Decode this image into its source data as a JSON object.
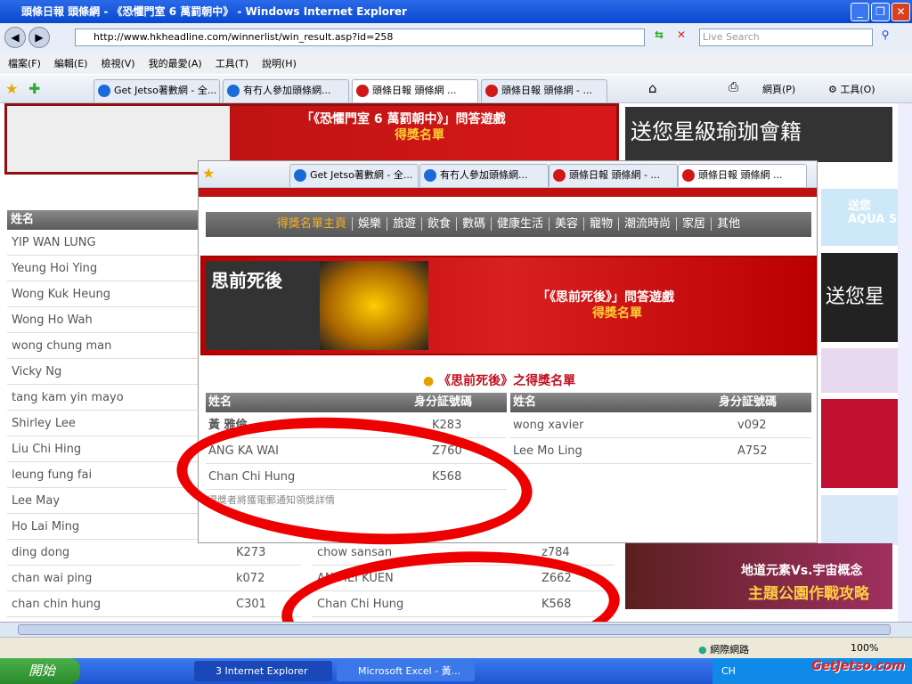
{
  "window": {
    "title": "頭條日報 頭條網 - 《恐懼門室 6 萬罰朝中》 - Windows Internet Explorer"
  },
  "address": {
    "url": "http://www.hkheadline.com/winnerlist/win_result.asp?id=258",
    "search_placeholder": "Live Search"
  },
  "menu": [
    "檔案(F)",
    "編輯(E)",
    "檢視(V)",
    "我的最愛(A)",
    "工具(T)",
    "說明(H)"
  ],
  "tabs": [
    "Get Jetso著數網 - 全...",
    "有冇人參加頭條網...",
    "頭條日報 頭條網 ...",
    "頭條日報 頭條網 - ..."
  ],
  "overlay_tabs": [
    "Get Jetso著數網 - 全...",
    "有冇人參加頭條網...",
    "頭條日報 頭條網 - ...",
    "頭條日報 頭條網 ..."
  ],
  "toolbar": {
    "page": "網頁(P)",
    "tools": "工具(O)"
  },
  "banner": {
    "title": "「《恐懼門室 6 萬罰朝中》」問答遊戲",
    "subtitle": "得獎名單",
    "ad": "送您星級瑜珈會籍"
  },
  "list": {
    "header": "姓名",
    "names": [
      "YIP WAN LUNG",
      "Yeung Hoi Ying",
      "Wong Kuk Heung",
      "Wong Ho Wah",
      "wong chung man",
      "Vicky Ng",
      "tang kam yin mayo",
      "Shirley Lee",
      "Liu Chi Hing",
      "leung fung fai",
      "Lee May",
      "Ho Lai Ming"
    ],
    "bottom_left": [
      {
        "name": "ding dong",
        "id": "K273"
      },
      {
        "name": "chan wai ping",
        "id": "k072"
      },
      {
        "name": "chan chin hung",
        "id": "C301"
      }
    ],
    "bottom_right": [
      {
        "name": "chow sansan",
        "id": "z784"
      },
      {
        "name": "AN MEI KUEN",
        "id": "Z662"
      },
      {
        "name": "Chan Chi Hung",
        "id": "K568"
      }
    ]
  },
  "overlay": {
    "nav": [
      "得獎名單主頁",
      "娛樂",
      "旅遊",
      "飲食",
      "數碼",
      "健康生活",
      "美容",
      "寵物",
      "潮流時尚",
      "家居",
      "其他"
    ],
    "banner_title": "「《思前死後》」問答遊戲",
    "banner_subtitle": "得獎名單",
    "book_title": "思前死後",
    "list_title": "《思前死後》之得獎名單",
    "col_name": "姓名",
    "col_id": "身分証號碼",
    "left": [
      {
        "name": "黃 雅倫",
        "id": "K283"
      },
      {
        "name": "ANG KA WAI",
        "id": "Z760"
      },
      {
        "name": "Chan Chi Hung",
        "id": "K568"
      }
    ],
    "right": [
      {
        "name": "wong xavier",
        "id": "v092"
      },
      {
        "name": "Lee Mo Ling",
        "id": "A752"
      }
    ],
    "note": "得獎者將獲電郵通知領獎詳情"
  },
  "right_ads": [
    "送您",
    "AQUA S",
    "送您星級"
  ],
  "bottom_ad": {
    "line1": "地道元素Vs.宇宙概念",
    "line2": "主題公園作戰攻略"
  },
  "status": {
    "zone": "網際網路",
    "zoom": "100%"
  },
  "taskbar": {
    "start": "開始",
    "items": [
      "3 Internet Explorer",
      "Microsoft Excel - 黃..."
    ],
    "lang": "CH"
  },
  "watermark": "GetJetso.com"
}
